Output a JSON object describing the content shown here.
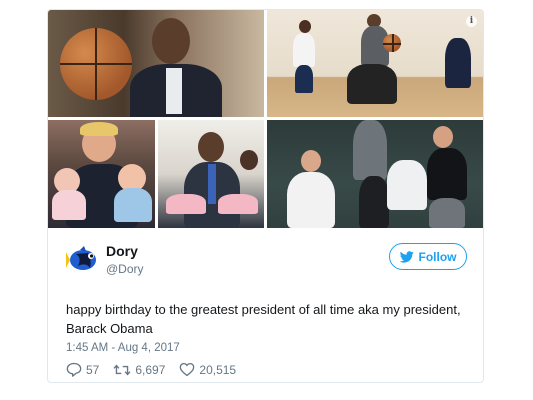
{
  "tweet": {
    "name": "Dory",
    "handle": "@Dory",
    "follow_label": "Follow",
    "text": "happy birthday to the greatest president of all time aka my president, Barack Obama",
    "timestamp": "1:45 AM - Aug 4, 2017",
    "replies": "57",
    "retweets": "6,697",
    "likes": "20,515"
  },
  "colors": {
    "accent": "#1da1f2",
    "secondary_text": "#657786",
    "primary_text": "#14171a"
  },
  "icons": {
    "info": "info-icon",
    "follow": "twitter-bird-icon",
    "reply": "reply-icon",
    "retweet": "retweet-icon",
    "like": "heart-icon"
  },
  "info_glyph": "i"
}
